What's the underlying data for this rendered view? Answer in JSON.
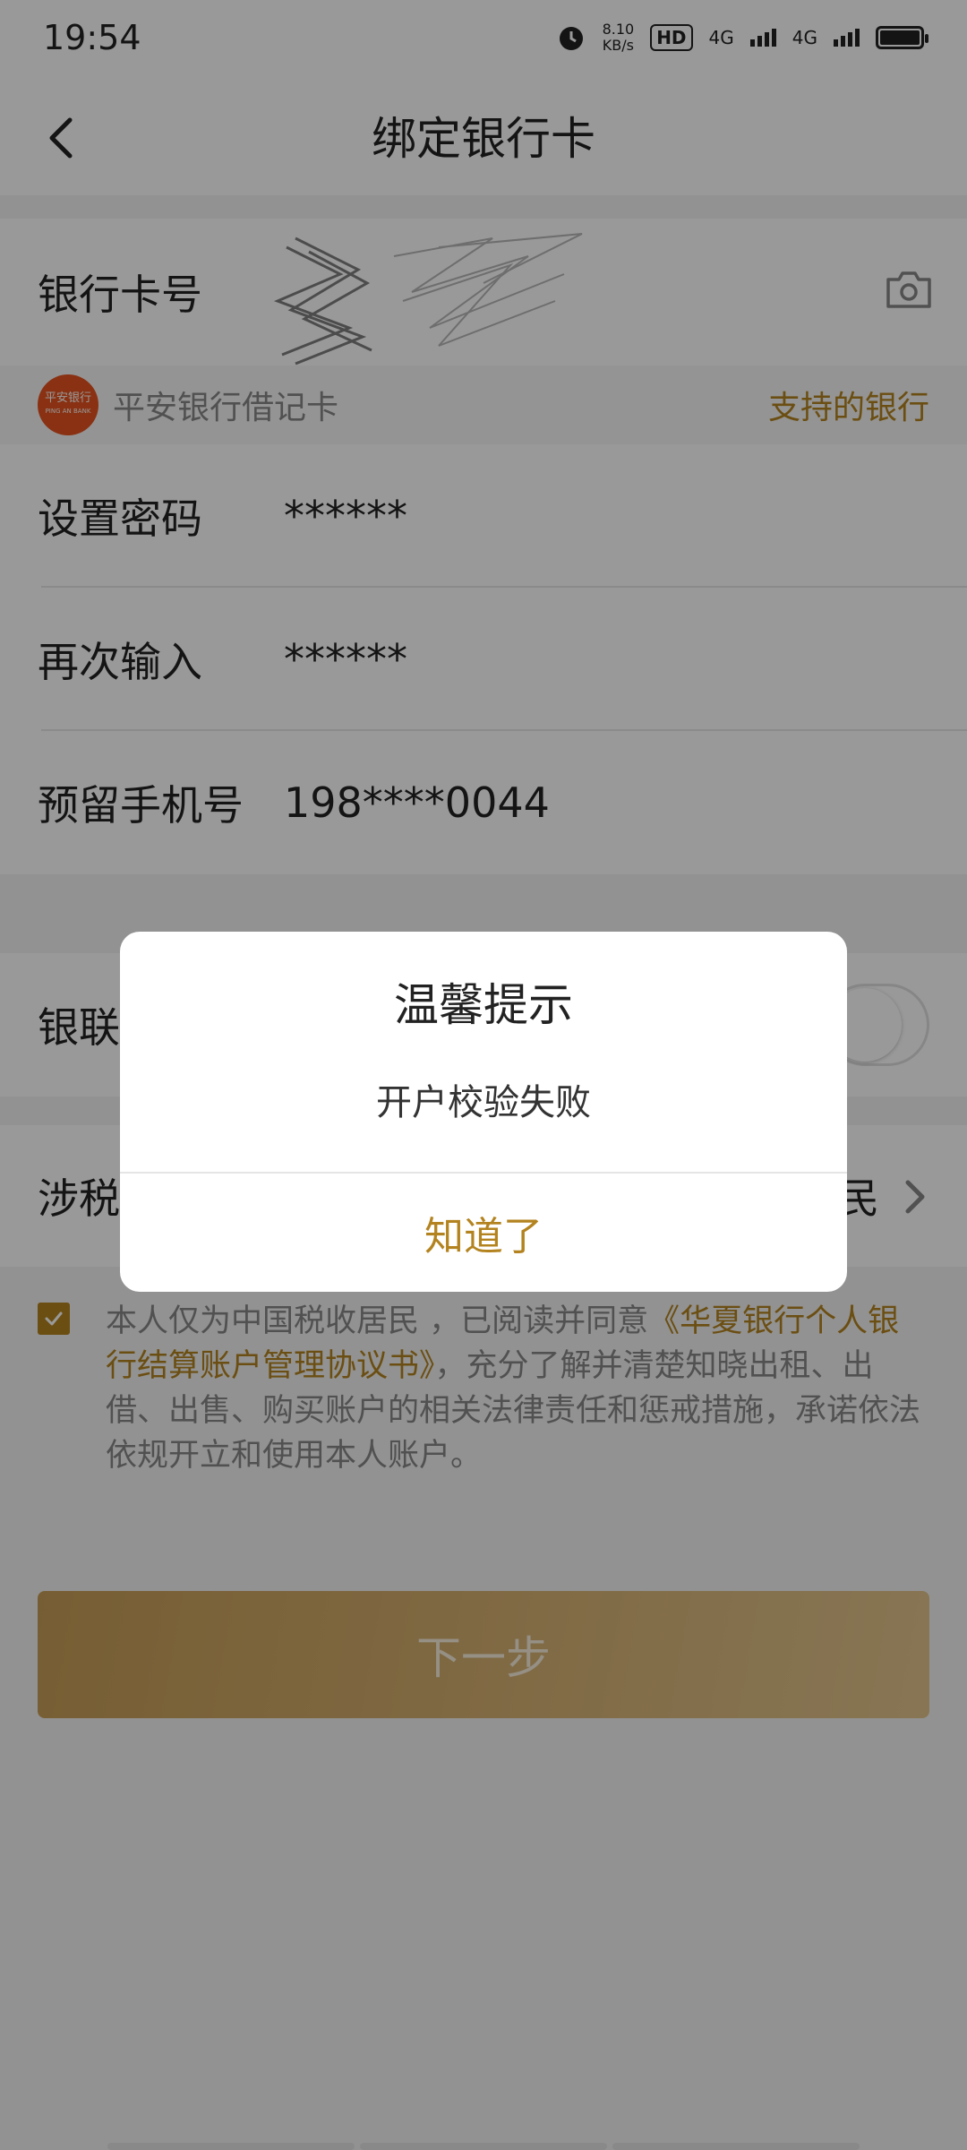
{
  "status_bar": {
    "time": "19:54",
    "net_speed_value": "8.10",
    "net_speed_unit": "KB/s",
    "hd_label": "HD",
    "sim1": "4G",
    "sim2": "4G"
  },
  "header": {
    "title": "绑定银行卡"
  },
  "card": {
    "label": "银行卡号",
    "bank_name": "平安银行借记卡",
    "bank_logo_text": "平安银行",
    "bank_logo_sub": "PING AN BANK",
    "support_link": "支持的银行"
  },
  "form": {
    "password_label": "设置密码",
    "password_value": "******",
    "confirm_label": "再次输入",
    "confirm_value": "******",
    "phone_label": "预留手机号",
    "phone_value": "198****0044"
  },
  "union": {
    "label_partial": "银联"
  },
  "tax": {
    "label_partial": "涉税",
    "value_partial": "民"
  },
  "agreement": {
    "text_before": "本人仅为中国税收居民 ，已阅读并同意",
    "link": "《华夏银行个人银行结算账户管理协议书》",
    "text_after": "，充分了解并清楚知晓出租、出借、出售、购买账户的相关法律责任和惩戒措施，承诺依法依规开立和使用本人账户。"
  },
  "next_button": "下一步",
  "dialog": {
    "title": "温馨提示",
    "message": "开户校验失败",
    "confirm": "知道了"
  },
  "colors": {
    "accent": "#b3831f",
    "bank_logo": "#e4521f",
    "button_gradient_start": "#c79c56",
    "button_gradient_end": "#e2c48c"
  }
}
